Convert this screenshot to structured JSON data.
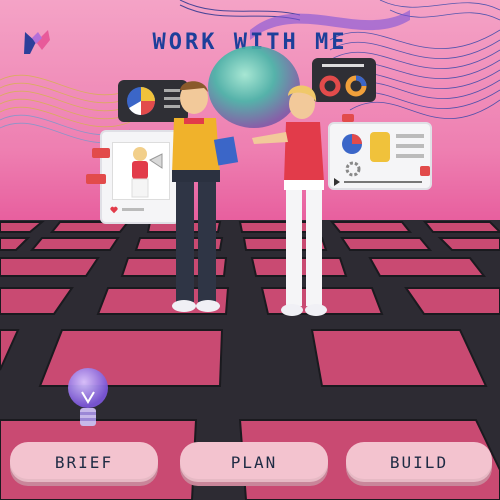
{
  "header": {
    "title": "WORK WITH ME"
  },
  "buttons": {
    "brief": "BRIEF",
    "plan": "PLAN",
    "build": "BUILD"
  },
  "colors": {
    "background": "#e75d9d",
    "title": "#1d3f9a",
    "button": "#f3c3cf",
    "floor": "#2d2b33",
    "tile": "#c94a72"
  },
  "icons": [
    "brand-logo-icon",
    "lightbulb-icon",
    "pie-chart-icon",
    "donut-chart-icon",
    "megaphone-icon",
    "heart-icon",
    "gear-icon",
    "play-icon"
  ]
}
